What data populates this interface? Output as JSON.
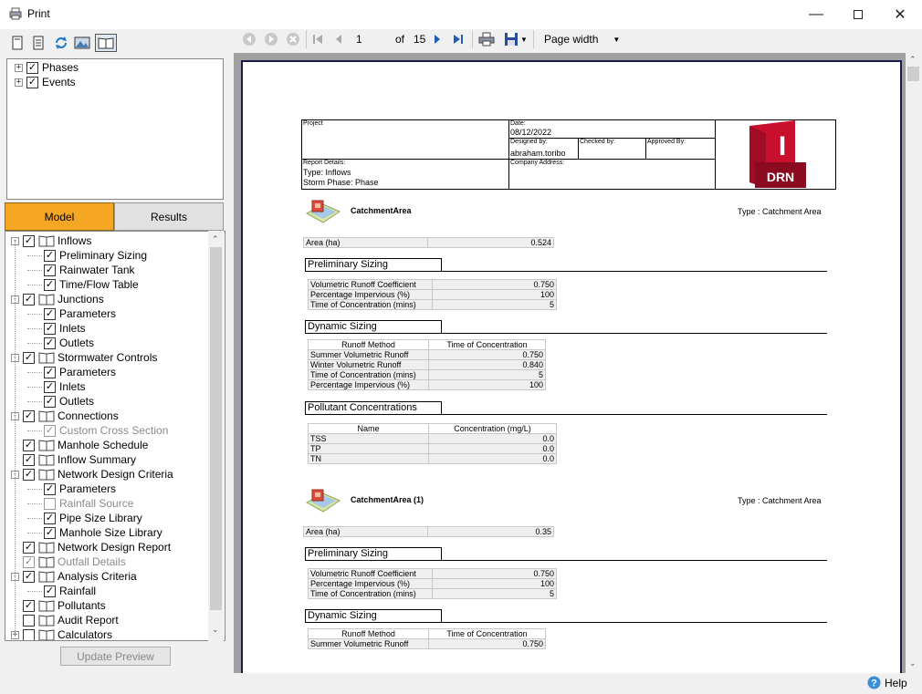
{
  "window": {
    "title": "Print"
  },
  "left_toolbar": {
    "icons": [
      "page-icon",
      "page-lines-icon",
      "refresh-icon",
      "image-preview-icon",
      "book-icon"
    ]
  },
  "phases_tree": [
    {
      "label": "Phases",
      "checked": true
    },
    {
      "label": "Events",
      "checked": true
    }
  ],
  "tabs": {
    "model": "Model",
    "results": "Results"
  },
  "tree": [
    {
      "label": "Inflows",
      "level": 0,
      "checked": true,
      "book": true,
      "exp": "-"
    },
    {
      "label": "Preliminary Sizing",
      "level": 1,
      "checked": true
    },
    {
      "label": "Rainwater Tank",
      "level": 1,
      "checked": true
    },
    {
      "label": "Time/Flow Table",
      "level": 1,
      "checked": true
    },
    {
      "label": "Junctions",
      "level": 0,
      "checked": true,
      "book": true,
      "exp": "-"
    },
    {
      "label": "Parameters",
      "level": 1,
      "checked": true
    },
    {
      "label": "Inlets",
      "level": 1,
      "checked": true
    },
    {
      "label": "Outlets",
      "level": 1,
      "checked": true
    },
    {
      "label": "Stormwater Controls",
      "level": 0,
      "checked": true,
      "book": true,
      "exp": "-"
    },
    {
      "label": "Parameters",
      "level": 1,
      "checked": true
    },
    {
      "label": "Inlets",
      "level": 1,
      "checked": true
    },
    {
      "label": "Outlets",
      "level": 1,
      "checked": true
    },
    {
      "label": "Connections",
      "level": 0,
      "checked": true,
      "book": true,
      "exp": "-"
    },
    {
      "label": "Custom Cross Section",
      "level": 1,
      "checked": true,
      "gray": true
    },
    {
      "label": "Manhole Schedule",
      "level": 0,
      "checked": true,
      "book": true
    },
    {
      "label": "Inflow Summary",
      "level": 0,
      "checked": true,
      "book": true
    },
    {
      "label": "Network Design Criteria",
      "level": 0,
      "checked": true,
      "book": true,
      "exp": "-"
    },
    {
      "label": "Parameters",
      "level": 1,
      "checked": true
    },
    {
      "label": "Rainfall Source",
      "level": 1,
      "checked": false,
      "gray": true
    },
    {
      "label": "Pipe Size Library",
      "level": 1,
      "checked": true
    },
    {
      "label": "Manhole Size Library",
      "level": 1,
      "checked": true
    },
    {
      "label": "Network Design Report",
      "level": 0,
      "checked": true,
      "book": true
    },
    {
      "label": "Outfall Details",
      "level": 0,
      "checked": true,
      "book": true,
      "gray": true
    },
    {
      "label": "Analysis Criteria",
      "level": 0,
      "checked": true,
      "book": true,
      "exp": "-"
    },
    {
      "label": "Rainfall",
      "level": 1,
      "checked": true
    },
    {
      "label": "Pollutants",
      "level": 0,
      "checked": true,
      "book": true
    },
    {
      "label": "Audit Report",
      "level": 0,
      "checked": false,
      "book": true
    },
    {
      "label": "Calculators",
      "level": 0,
      "checked": false,
      "book": true,
      "exp": "+"
    }
  ],
  "update_button": "Update Preview",
  "nav": {
    "page": "1",
    "of_label": "of",
    "total": "15",
    "zoom": "Page width"
  },
  "help": "Help",
  "report": {
    "header": {
      "project_label": "Project",
      "date_label": "Date:",
      "date": "08/12/2022",
      "designed_label": "Designed by:",
      "designed": "abraham.toribo",
      "checked_label": "Checked by:",
      "approved_label": "Approved By:",
      "details_label": "Report Details:",
      "type_line": "Type: Inflows",
      "phase_line": "Storm Phase: Phase",
      "company_label": "Company Address:",
      "logo_letter": "I",
      "logo_text": "DRN"
    },
    "blocks": [
      {
        "name": "CatchmentArea",
        "type": "Type : Catchment Area",
        "area_label": "Area (ha)",
        "area": "0.524",
        "prelim_title": "Preliminary Sizing",
        "prelim": [
          [
            "Volumetric Runoff Coefficient",
            "0.750"
          ],
          [
            "Percentage Impervious (%)",
            "100"
          ],
          [
            "Time of Concentration (mins)",
            "5"
          ]
        ],
        "dyn_title": "Dynamic Sizing",
        "dyn_header": [
          "Runoff Method",
          "Time of Concentration"
        ],
        "dyn": [
          [
            "Summer Volumetric Runoff",
            "0.750"
          ],
          [
            "Winter Volumetric Runoff",
            "0.840"
          ],
          [
            "Time of Concentration (mins)",
            "5"
          ],
          [
            "Percentage Impervious (%)",
            "100"
          ]
        ],
        "poll_title": "Pollutant Concentrations",
        "poll_header": [
          "Name",
          "Concentration (mg/L)"
        ],
        "poll": [
          [
            "TSS",
            "0.0"
          ],
          [
            "TP",
            "0.0"
          ],
          [
            "TN",
            "0.0"
          ]
        ]
      },
      {
        "name": "CatchmentArea (1)",
        "type": "Type : Catchment Area",
        "area_label": "Area (ha)",
        "area": "0.35",
        "prelim_title": "Preliminary Sizing",
        "prelim": [
          [
            "Volumetric Runoff Coefficient",
            "0.750"
          ],
          [
            "Percentage Impervious (%)",
            "100"
          ],
          [
            "Time of Concentration (mins)",
            "5"
          ]
        ],
        "dyn_title": "Dynamic Sizing",
        "dyn_header": [
          "Runoff Method",
          "Time of Concentration"
        ],
        "dyn": [
          [
            "Summer Volumetric Runoff",
            "0.750"
          ]
        ]
      }
    ]
  }
}
